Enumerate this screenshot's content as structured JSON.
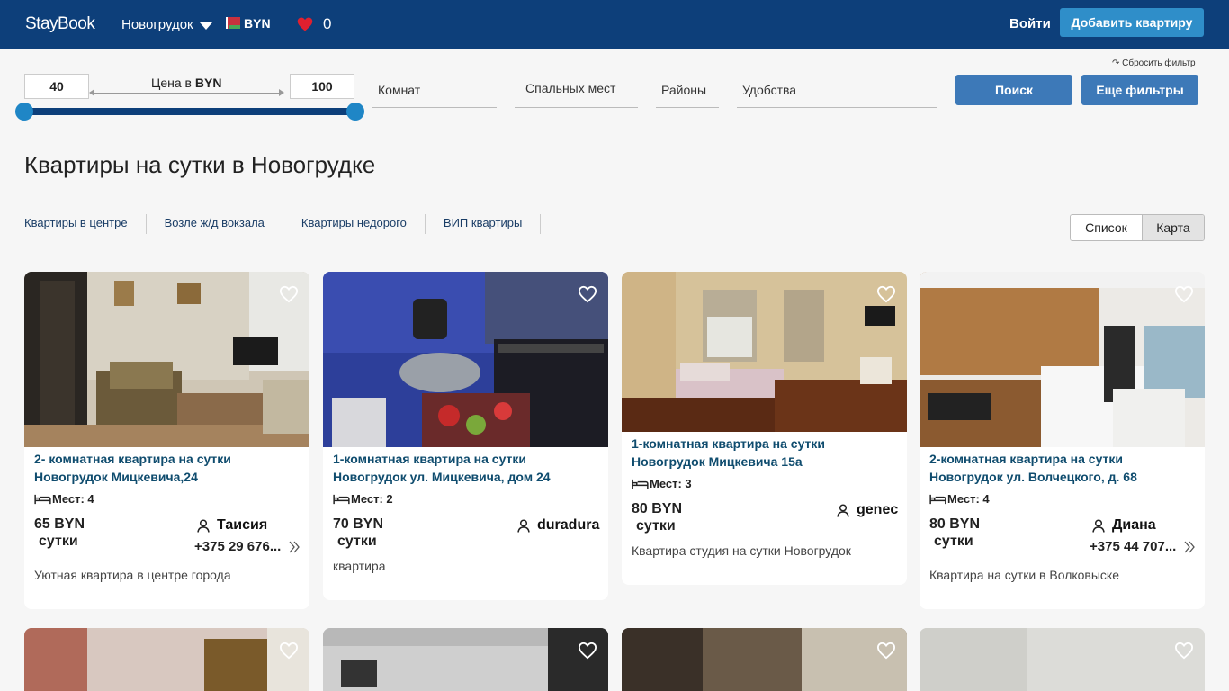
{
  "header": {
    "logo": "StayBook",
    "city": "Новогрудок",
    "currency": "BYN",
    "favorites_count": "0",
    "login": "Войти",
    "add_apartment": "Добавить квартиру"
  },
  "filters": {
    "reset": "↷ Сбросить фильтр",
    "price_min": "40",
    "price_max": "100",
    "price_label_prefix": "Цена в",
    "price_label_currency": "BYN",
    "rooms": "Комнат",
    "beds": "Спальных мест",
    "districts": "Районы",
    "amenities": "Удобства",
    "search_button": "Поиск",
    "more_filters_button": "Еще фильтры"
  },
  "page_title": "Квартиры на сутки в Новогрудке",
  "quick_links": [
    "Квартиры в центре",
    "Возле ж/д вокзала",
    "Квартиры недорого",
    "ВИП квартиры"
  ],
  "view_toggle": {
    "list": "Список",
    "map": "Карта"
  },
  "listings": [
    {
      "title_line1": "2- комнатная квартира на сутки",
      "title_line2": "Новогрудок Мицкевича,24",
      "places": "Мест: 4",
      "price": "65 BYN",
      "per": "сутки",
      "owner": "Таисия",
      "phone": "+375 29 676...",
      "description": "Уютная квартира в центре города"
    },
    {
      "title_line1": "1-комнатная квартира на сутки",
      "title_line2": "Новогрудок ул. Мицкевича, дом 24",
      "places": "Мест: 2",
      "price": "70 BYN",
      "per": "сутки",
      "owner": "duradura",
      "phone": "",
      "description": "квартира"
    },
    {
      "title_line1": "1-комнатная квартира на сутки",
      "title_line2": "Новогрудок Мицкевича 15а",
      "places": "Мест: 3",
      "price": "80 BYN",
      "per": "сутки",
      "owner": "genec",
      "phone": "",
      "description": "Квартира студия на сутки Новогрудок"
    },
    {
      "title_line1": "2-комнатная квартира на сутки",
      "title_line2": "Новогрудок ул. Волчецкого, д. 68",
      "places": "Мест: 4",
      "price": "80 BYN",
      "per": "сутки",
      "owner": "Диана",
      "phone": "+375 44 707...",
      "description": "Квартира на сутки в Волковыске"
    }
  ],
  "colors": {
    "header_bg": "#0d3f7a",
    "accent_button": "#2f8ec9",
    "filter_button": "#3d79b8",
    "title_link": "#0f4c6e",
    "favorite_heart": "#e0202f"
  }
}
